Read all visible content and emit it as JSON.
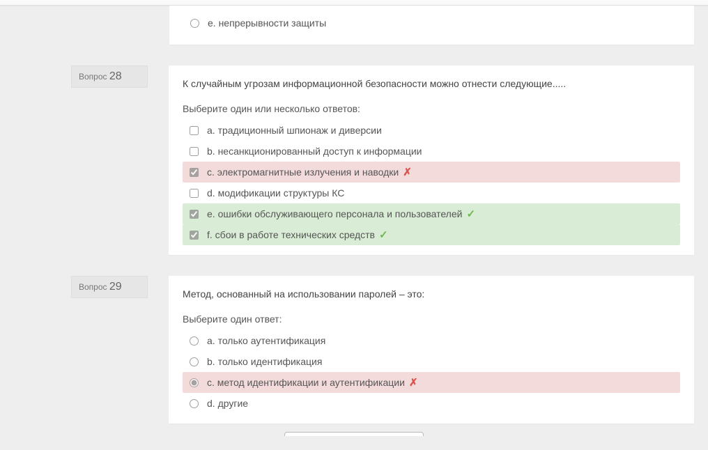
{
  "partial": {
    "option_e": "e. непрерывности защиты"
  },
  "q28": {
    "label_word": "Вопрос",
    "label_num": "28",
    "text": "К случайным угрозам информационной безопасности можно отнести следующие.....",
    "prompt": "Выберите один или несколько ответов:",
    "options": {
      "a": "a. традиционный шпионаж и диверсии",
      "b": "b. несанкционированный доступ к информации",
      "c": "c. электромагнитные излучения и наводки",
      "d": "d. модификации структуры КС",
      "e": "e. ошибки обслуживающего персонала и пользователей",
      "f": "f. сбои в работе технических средств"
    }
  },
  "q29": {
    "label_word": "Вопрос",
    "label_num": "29",
    "text": "Метод, основанный на использовании паролей – это:",
    "prompt": "Выберите один ответ:",
    "options": {
      "a": "a. только аутентификация",
      "b": "b. только идентификация",
      "c": "c. метод идентификации и аутентификации",
      "d": "d. другие"
    }
  }
}
